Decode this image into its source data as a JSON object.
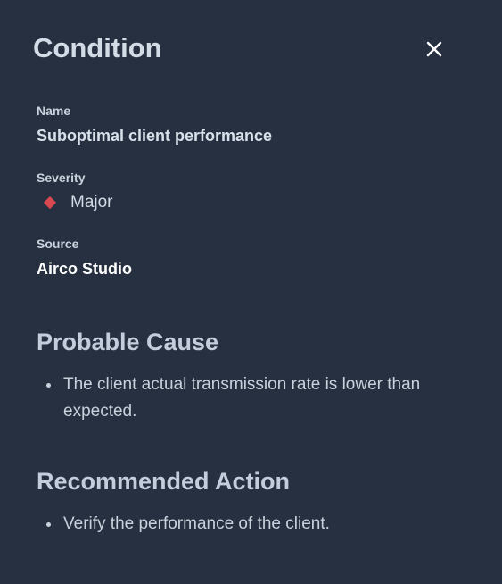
{
  "panel": {
    "title": "Condition",
    "close_icon": "close-icon"
  },
  "fields": {
    "name": {
      "label": "Name",
      "value": "Suboptimal client performance"
    },
    "severity": {
      "label": "Severity",
      "value": "Major",
      "icon": "diamond-icon",
      "color": "#d9474f"
    },
    "source": {
      "label": "Source",
      "value": "Airco Studio"
    }
  },
  "probable_cause": {
    "heading": "Probable Cause",
    "items": [
      "The client actual transmission rate is lower than expected."
    ]
  },
  "recommended_action": {
    "heading": "Recommended Action",
    "items": [
      "Verify the performance of the client."
    ]
  },
  "colors": {
    "background": "#263040",
    "text": "#c9d1dc",
    "severity_major": "#d9474f"
  }
}
